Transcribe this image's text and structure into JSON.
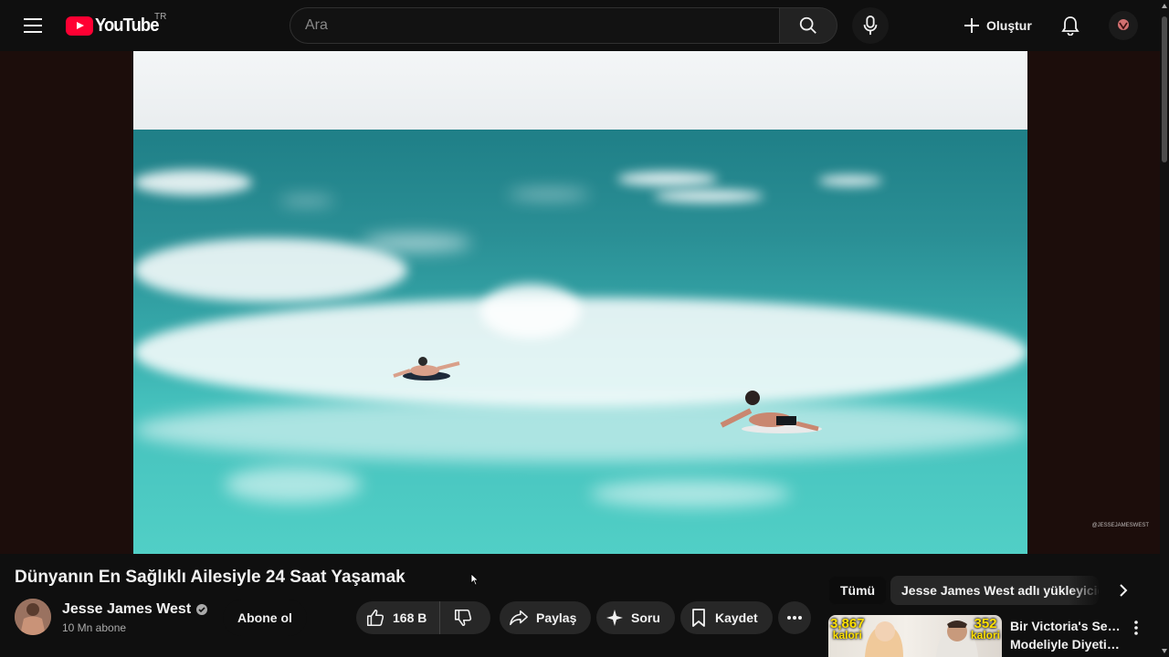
{
  "masthead": {
    "logo_text": "YouTube",
    "country_code": "TR",
    "search_placeholder": "Ara",
    "create_label": "Oluştur"
  },
  "video": {
    "title": "Dünyanın En Sağlıklı Ailesiyle 24 Saat Yaşamak",
    "watermark": "@JESSEJAMESWEST"
  },
  "channel": {
    "name": "Jesse James West",
    "subscribers": "10 Mn abone",
    "subscribe_label": "Abone ol"
  },
  "actions": {
    "like_count": "168 B",
    "share_label": "Paylaş",
    "ask_label": "Soru",
    "save_label": "Kaydet"
  },
  "filter_chips": [
    {
      "label": "Tümü",
      "selected": true
    },
    {
      "label": "Jesse James West adlı yükleyiciden"
    }
  ],
  "recommended": [
    {
      "title_line1": "Bir Victoria's Secret",
      "title_line2": "Modeliyle Diyetim...",
      "thumb_left_kcal": "3,867",
      "thumb_right_kcal": "352",
      "thumb_kcal_unit": "kalori"
    }
  ],
  "colors": {
    "background": "#0f0f0f",
    "brand_red": "#ff0033",
    "pill_bg": "#272727",
    "player_bg": "#1c0d0b"
  },
  "icons": {
    "menu": "hamburger-menu-icon",
    "search": "search-icon",
    "mic": "microphone-icon",
    "create": "plus-icon",
    "notifications": "bell-icon",
    "like": "thumbs-up-icon",
    "dislike": "thumbs-down-icon",
    "share": "share-arrow-icon",
    "ask": "sparkle-icon",
    "save": "bookmark-icon",
    "more": "more-horizontal-icon",
    "verified": "verified-check-icon"
  }
}
